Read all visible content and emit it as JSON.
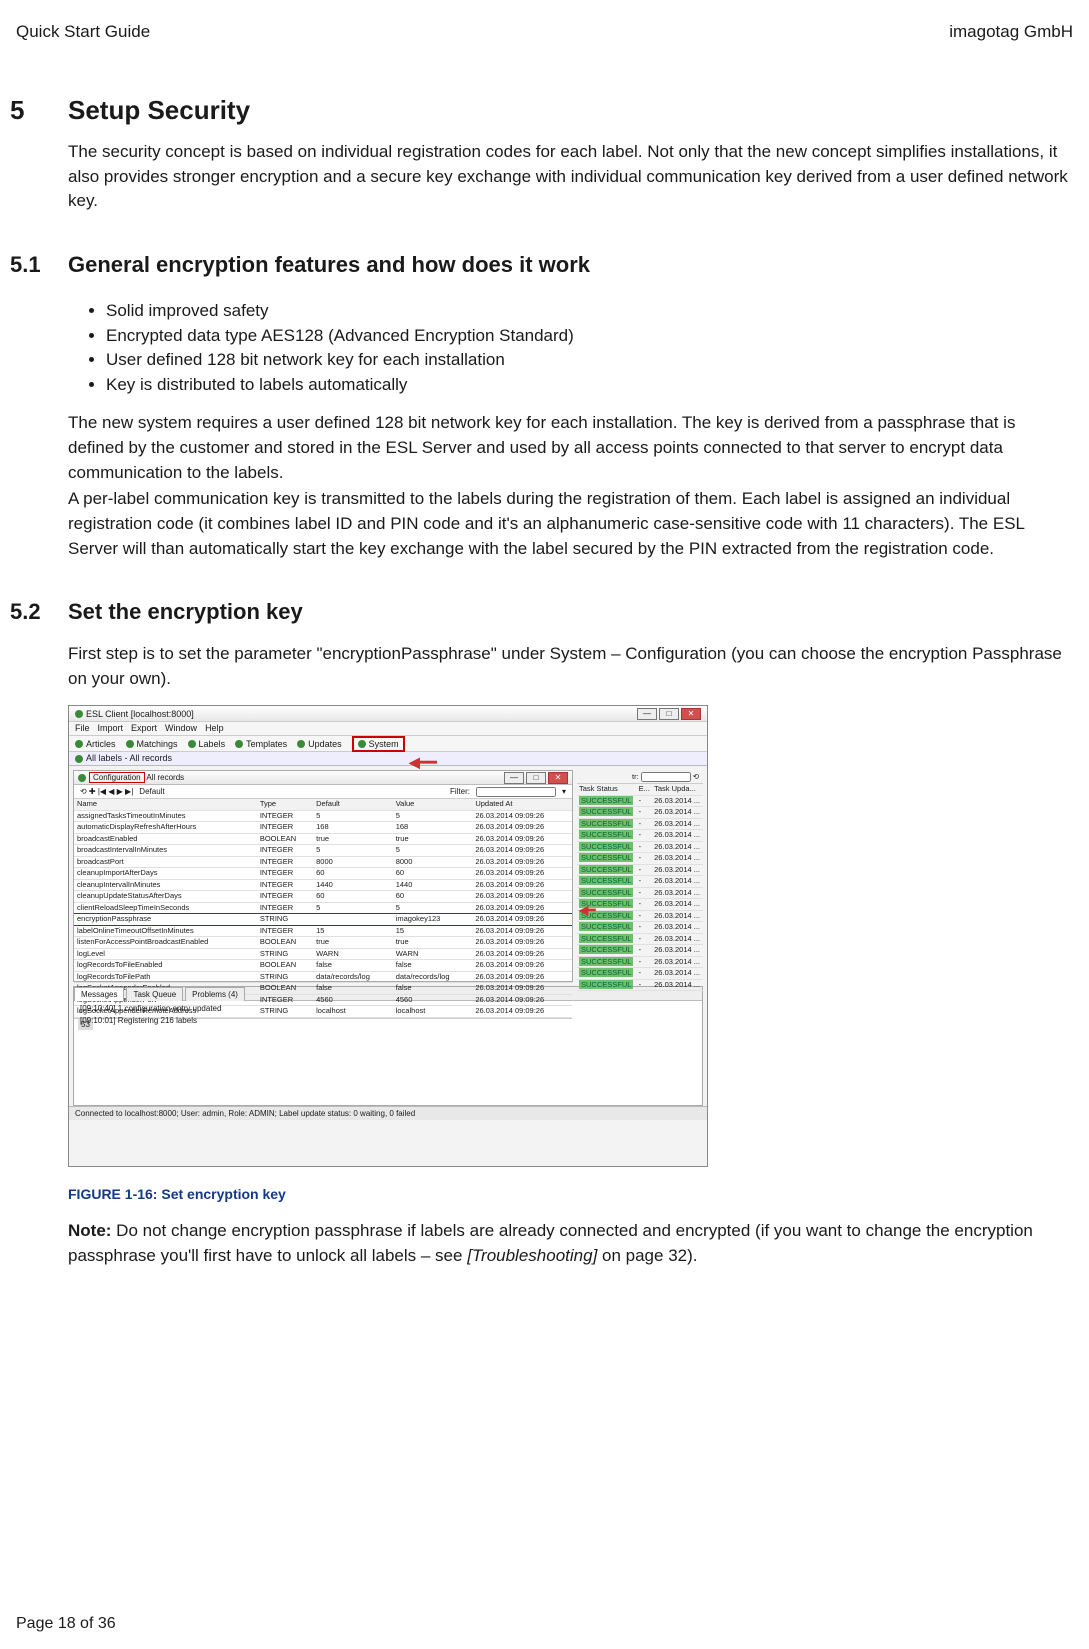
{
  "header": {
    "left": "Quick Start Guide",
    "right": "imagotag GmbH"
  },
  "sec5": {
    "num": "5",
    "title": "Setup Security",
    "p1": "The security concept is based on individual registration codes for each label. Not only that the new concept simplifies installations, it also provides stronger encryption and a secure key exchange with individual communication key derived from a user defined network key."
  },
  "sec51": {
    "num": "5.1",
    "title": "General encryption features and how does it work",
    "bullets": [
      "Solid improved safety",
      "Encrypted data type AES128 (Advanced Encryption Standard)",
      "User defined 128 bit network key for each installation",
      "Key is distributed to labels automatically"
    ],
    "p1": "The new system requires a user defined 128 bit network key for each installation. The key is derived from a passphrase that is defined by the customer and stored in the ESL Server and used by all access points connected to that server to encrypt data communication to the labels.",
    "p2": "A per-label communication key is transmitted to the labels during the registration of them. Each label is assigned an individual registration code (it combines label ID and PIN code and it's an alphanumeric case-sensitive code with 11 characters). The ESL Server will than automatically start the key exchange with the label secured by the PIN extracted from the registration code."
  },
  "sec52": {
    "num": "5.2",
    "title": "Set the encryption key",
    "p1": "First step is to set the parameter \"encryptionPassphrase\" under System – Configuration (you can choose the encryption Passphrase on your own)."
  },
  "figure": {
    "window_title": "ESL Client [localhost:8000]",
    "menubar": [
      "File",
      "Import",
      "Export",
      "Window",
      "Help"
    ],
    "tabs": [
      "Articles",
      "Matchings",
      "Labels",
      "Templates",
      "Updates",
      "System"
    ],
    "subheader": "All labels - All records",
    "config_title_a": "Configuration",
    "config_title_b": "All records",
    "toolbar_text": "Default",
    "filter_label": "Filter:",
    "rhs_label": "tr:",
    "cols": [
      "Name",
      "Type",
      "Default",
      "Value",
      "Updated At"
    ],
    "rows": [
      [
        "assignedTasksTimeoutInMinutes",
        "INTEGER",
        "5",
        "5",
        "26.03.2014 09:09:26"
      ],
      [
        "automaticDisplayRefreshAfterHours",
        "INTEGER",
        "168",
        "168",
        "26.03.2014 09:09:26"
      ],
      [
        "broadcastEnabled",
        "BOOLEAN",
        "true",
        "true",
        "26.03.2014 09:09:26"
      ],
      [
        "broadcastIntervalInMinutes",
        "INTEGER",
        "5",
        "5",
        "26.03.2014 09:09:26"
      ],
      [
        "broadcastPort",
        "INTEGER",
        "8000",
        "8000",
        "26.03.2014 09:09:26"
      ],
      [
        "cleanupImportAfterDays",
        "INTEGER",
        "60",
        "60",
        "26.03.2014 09:09:26"
      ],
      [
        "cleanupIntervalInMinutes",
        "INTEGER",
        "1440",
        "1440",
        "26.03.2014 09:09:26"
      ],
      [
        "cleanupUpdateStatusAfterDays",
        "INTEGER",
        "60",
        "60",
        "26.03.2014 09:09:26"
      ],
      [
        "clientReloadSleepTimeInSeconds",
        "INTEGER",
        "5",
        "5",
        "26.03.2014 09:09:26"
      ],
      [
        "encryptionPassphrase",
        "STRING",
        "",
        "imagokey123",
        "26.03.2014 09:09:26"
      ],
      [
        "labelOnlineTimeoutOffsetInMinutes",
        "INTEGER",
        "15",
        "15",
        "26.03.2014 09:09:26"
      ],
      [
        "listenForAccessPointBroadcastEnabled",
        "BOOLEAN",
        "true",
        "true",
        "26.03.2014 09:09:26"
      ],
      [
        "logLevel",
        "STRING",
        "WARN",
        "WARN",
        "26.03.2014 09:09:26"
      ],
      [
        "logRecordsToFileEnabled",
        "BOOLEAN",
        "false",
        "false",
        "26.03.2014 09:09:26"
      ],
      [
        "logRecordsToFilePath",
        "STRING",
        "data/records/log",
        "data/records/log",
        "26.03.2014 09:09:26"
      ],
      [
        "logSocketAppenderEnabled",
        "BOOLEAN",
        "false",
        "false",
        "26.03.2014 09:09:26"
      ],
      [
        "logSocketAppenderPort",
        "INTEGER",
        "4560",
        "4560",
        "26.03.2014 09:09:26"
      ],
      [
        "logSocketAppenderRemoteAddress",
        "STRING",
        "localhost",
        "localhost",
        "26.03.2014 09:09:26"
      ]
    ],
    "row_count_label": "53",
    "side_cols": [
      "Task Status",
      "E...",
      "Task Upda..."
    ],
    "side_rows": [
      [
        "SUCCESSFUL",
        "-",
        "26.03.2014 ..."
      ],
      [
        "SUCCESSFUL",
        "-",
        "26.03.2014 ..."
      ],
      [
        "SUCCESSFUL",
        "-",
        "26.03.2014 ..."
      ],
      [
        "SUCCESSFUL",
        "-",
        "26.03.2014 ..."
      ],
      [
        "SUCCESSFUL",
        "-",
        "26.03.2014 ..."
      ],
      [
        "SUCCESSFUL",
        "-",
        "26.03.2014 ..."
      ],
      [
        "SUCCESSFUL",
        "-",
        "26.03.2014 ..."
      ],
      [
        "SUCCESSFUL",
        "-",
        "26.03.2014 ..."
      ],
      [
        "SUCCESSFUL",
        "-",
        "26.03.2014 ..."
      ],
      [
        "SUCCESSFUL",
        "-",
        "26.03.2014 ..."
      ],
      [
        "SUCCESSFUL",
        "-",
        "26.03.2014 ..."
      ],
      [
        "SUCCESSFUL",
        "-",
        "26.03.2014 ..."
      ],
      [
        "SUCCESSFUL",
        "-",
        "26.03.2014 ..."
      ],
      [
        "SUCCESSFUL",
        "-",
        "26.03.2014 ..."
      ],
      [
        "SUCCESSFUL",
        "-",
        "26.03.2014 ..."
      ],
      [
        "SUCCESSFUL",
        "-",
        "26.03.2014 ..."
      ],
      [
        "SUCCESSFUL",
        "-",
        "26.03.2014 ..."
      ]
    ],
    "msg_tabs": [
      "Messages",
      "Task Queue",
      "Problems (4)"
    ],
    "msg_lines": [
      "[09:10:40] 1 configuration entry updated",
      "[09:10:01] Registering 216 labels"
    ],
    "statusbar": "Connected to localhost:8000; User: admin, Role: ADMIN; Label update status: 0 waiting, 0 failed",
    "caption": "FIGURE 1-16: Set encryption key"
  },
  "note": {
    "label": "Note:",
    "text1": " Do not change encryption passphrase if labels are already connected and encrypted (if you want to change the encryption passphrase you'll first have to unlock all labels – see ",
    "text2_italic": "[Troubleshooting]",
    "text3": " on page 32)."
  },
  "footer": "Page 18 of 36"
}
